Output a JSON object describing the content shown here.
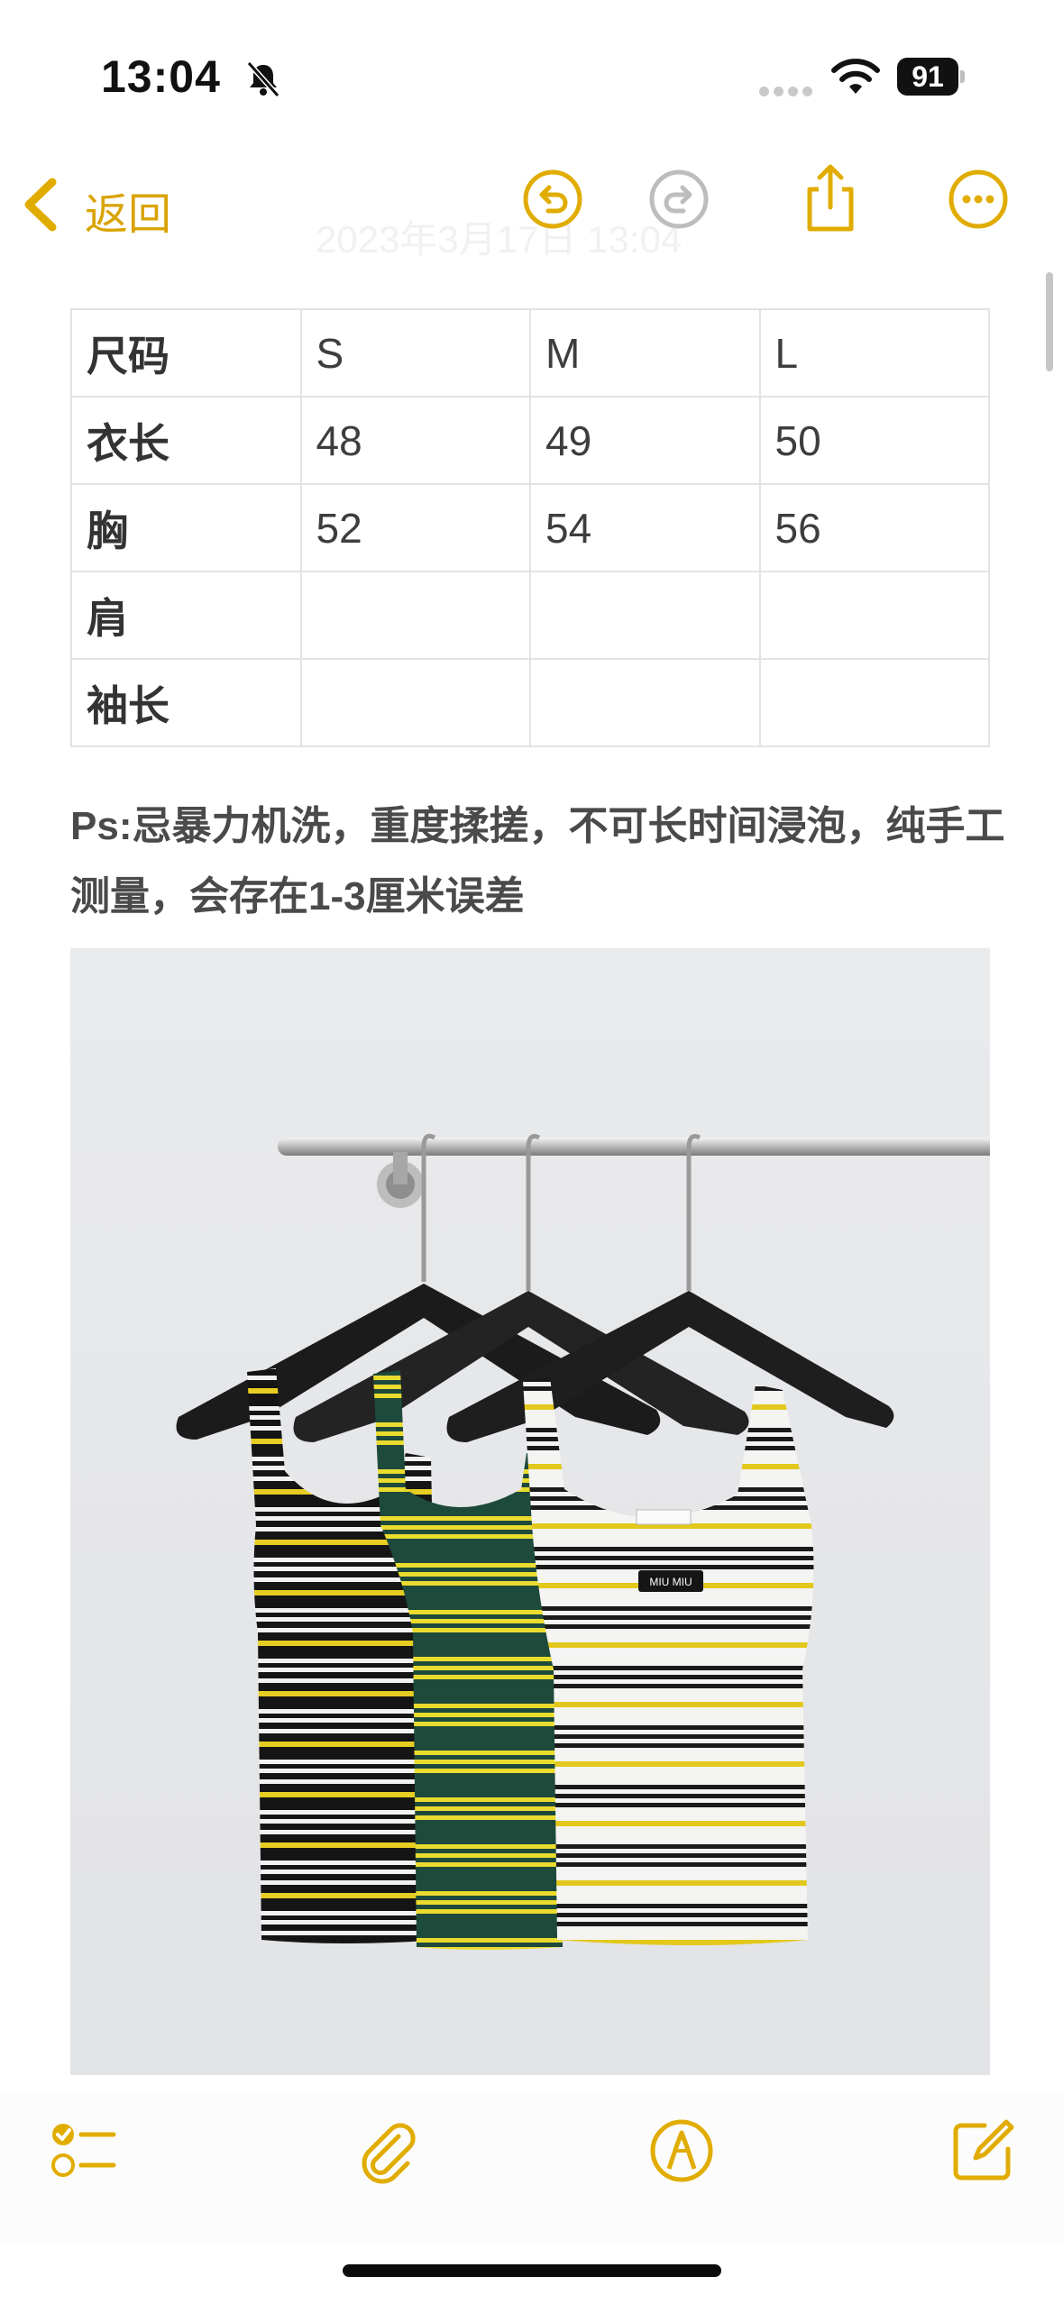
{
  "status": {
    "time": "13:04",
    "battery": "91"
  },
  "nav": {
    "back_label": "返回",
    "faded_date": "2023年3月17日 13:04"
  },
  "colors": {
    "accent": "#E1AC00",
    "disabled": "#BDBDBD"
  },
  "table": {
    "rows": [
      [
        "尺码",
        "S",
        "M",
        "L"
      ],
      [
        "衣长",
        "48",
        "49",
        "50"
      ],
      [
        "胸",
        "52",
        "54",
        "56"
      ],
      [
        "肩",
        "",
        "",
        ""
      ],
      [
        "袖长",
        "",
        "",
        ""
      ]
    ]
  },
  "note": "Ps:忌暴力机洗，重度揉搓，不可长时间浸泡，纯手工测量，会存在1-3厘米误差",
  "photo": {
    "label_text": "MIU MIU"
  },
  "icons": {
    "back": "chevron-left-icon",
    "undo": "undo-icon",
    "redo": "redo-icon",
    "share": "share-icon",
    "more": "more-icon",
    "checklist": "checklist-icon",
    "attach": "paperclip-icon",
    "markup": "markup-pen-icon",
    "compose": "compose-icon"
  }
}
